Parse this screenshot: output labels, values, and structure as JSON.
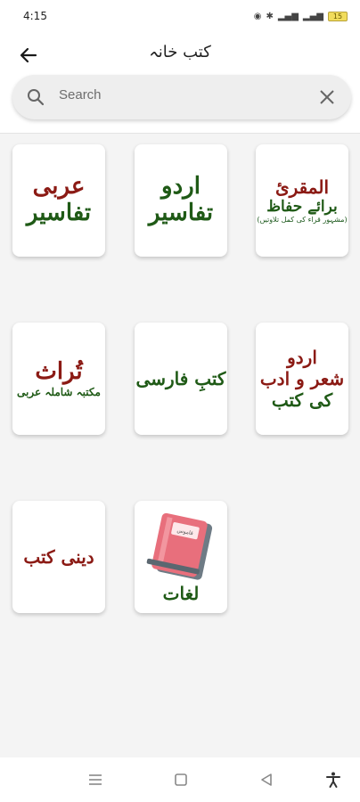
{
  "status_bar": {
    "time": "4:15",
    "battery": "15"
  },
  "header": {
    "title": "کتب خانہ",
    "back_icon": "arrow-left-icon"
  },
  "search": {
    "placeholder": "Search",
    "value": "",
    "clear_icon": "close-icon",
    "search_icon": "search-icon"
  },
  "tiles": [
    {
      "lines": [
        "المقرئ",
        "برائے حفاظ",
        "(مشہور قراء کی کمل تلاوتیں)"
      ],
      "colors": [
        "#8b1a14",
        "#1f5a16",
        "#1f5a16"
      ]
    },
    {
      "lines": [
        "اردو",
        "تفاسیر"
      ],
      "colors": [
        "#1f5a16",
        "#1f5a16"
      ]
    },
    {
      "lines": [
        "عربی",
        "تفاسیر"
      ],
      "colors": [
        "#8b1a14",
        "#1f5a16"
      ]
    },
    {
      "lines": [
        "اردو",
        "شعر و ادب",
        "کی کتب"
      ],
      "colors": [
        "#8b1a14",
        "#8b1a14",
        "#1f5a16"
      ]
    },
    {
      "lines": [
        "کتبِ فارسی"
      ],
      "colors": [
        "#1f5a16"
      ]
    },
    {
      "lines": [
        "تُراث",
        "مکتبہ شاملہ عربی"
      ],
      "colors": [
        "#8b1a14",
        "#1f5a16"
      ]
    },
    {
      "lines": [
        "لغات"
      ],
      "colors": [
        "#1f5a16"
      ],
      "book_label": "قاموس"
    },
    {
      "lines": [
        "دینی کتب"
      ],
      "colors": [
        "#8b1a14"
      ]
    }
  ],
  "nav": {
    "menu_icon": "menu-icon",
    "home_icon": "square-icon",
    "back_icon": "triangle-back-icon",
    "accessibility_icon": "accessibility-icon"
  }
}
